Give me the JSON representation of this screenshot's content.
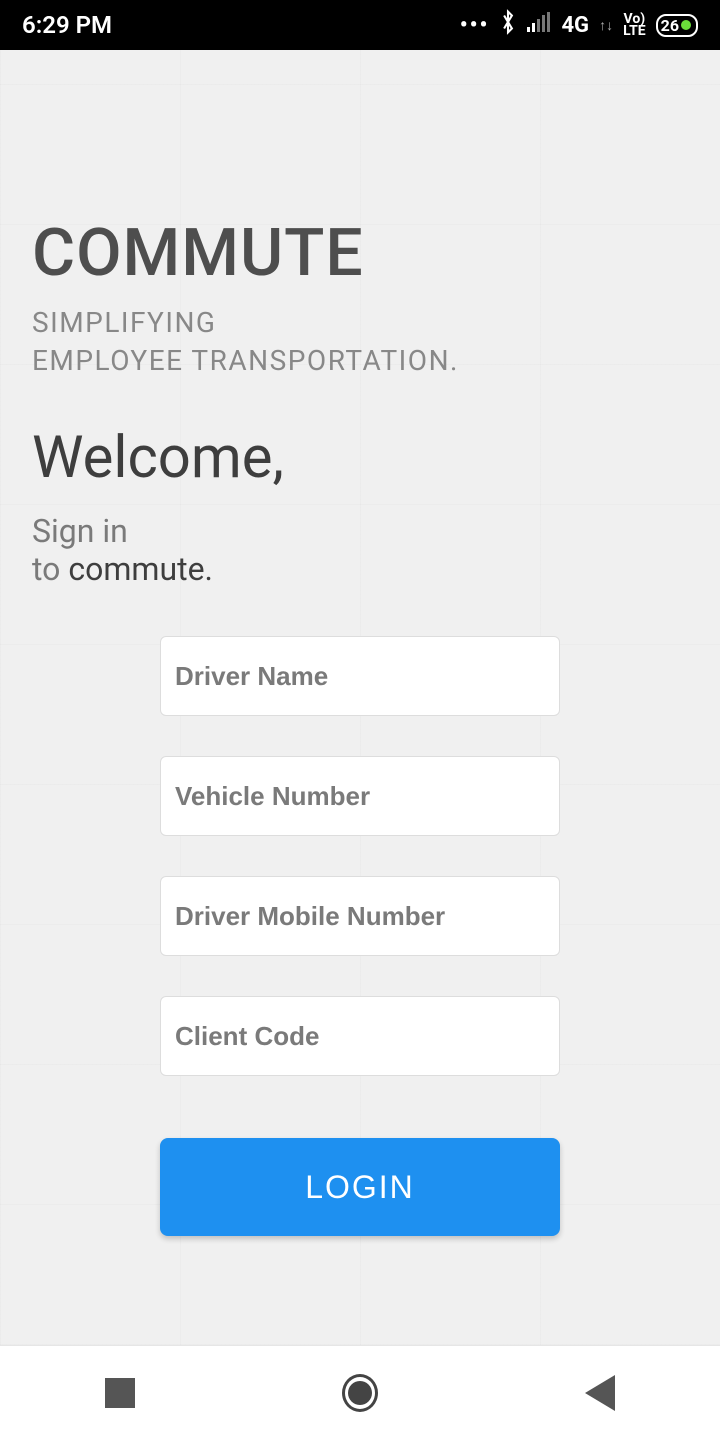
{
  "status": {
    "time": "6:29 PM",
    "network": "4G",
    "volte_top": "Vo)",
    "volte_bot": "LTE",
    "battery": "26"
  },
  "brand": {
    "title": "COMMUTE",
    "sub1": "SIMPLIFYING",
    "sub2": "EMPLOYEE TRANSPORTATION."
  },
  "welcome": {
    "title": "Welcome,",
    "signin_1": "Sign in",
    "signin_2_prefix": "to ",
    "signin_2_emph": "commute."
  },
  "form": {
    "driver_name_placeholder": "Driver Name",
    "vehicle_number_placeholder": "Vehicle Number",
    "driver_mobile_placeholder": "Driver Mobile Number",
    "client_code_placeholder": "Client Code",
    "login_label": "LOGIN"
  },
  "colors": {
    "primary": "#1e90f0"
  }
}
